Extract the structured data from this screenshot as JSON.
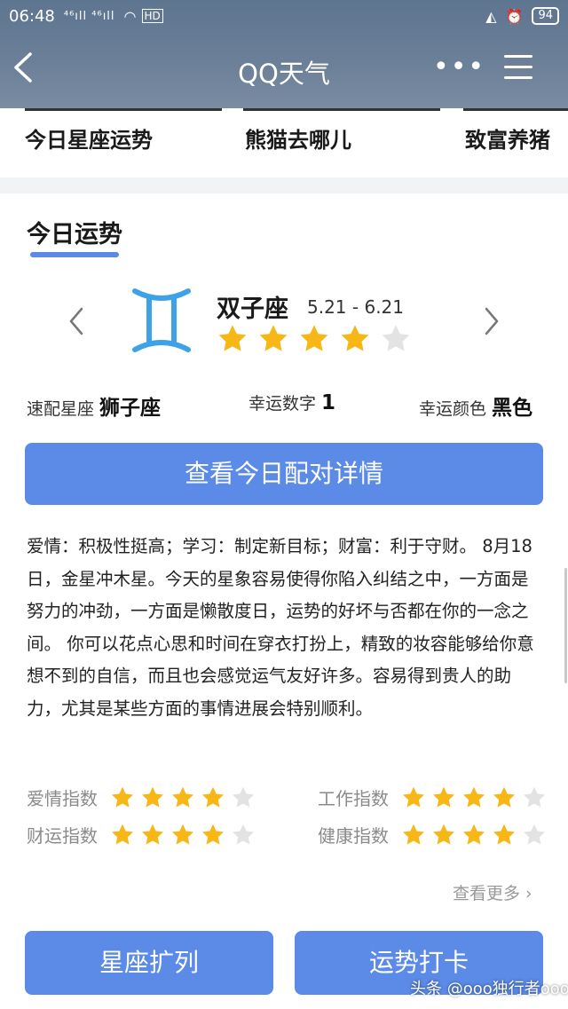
{
  "status_bar": {
    "time": "06:48",
    "signal": "⁴⁶ıll ⁴⁶ıll",
    "hd": "HD",
    "battery": "94"
  },
  "header": {
    "title": "QQ天气",
    "more": "•••"
  },
  "top_cards": [
    {
      "label": "今日星座运势"
    },
    {
      "label": "熊猫去哪儿"
    },
    {
      "label": "致富养猪"
    }
  ],
  "fortune": {
    "section_title": "今日运势",
    "sign_name": "双子座",
    "sign_dates": "5.21 - 6.21",
    "rating": 4,
    "max_rating": 5,
    "match_label": "速配星座",
    "match_value": "狮子座",
    "lucky_number_label": "幸运数字",
    "lucky_number_value": "1",
    "lucky_color_label": "幸运颜色",
    "lucky_color_value": "黑色",
    "detail_button": "查看今日配对详情",
    "description": "爱情：积极性挺高；学习：制定新目标；财富：利于守财。 8月18日，金星冲木星。今天的星象容易使得你陷入纠结之中，一方面是努力的冲劲，一方面是懒散度日，运势的好坏与否都在你的一念之间。 你可以花点心思和时间在穿衣打扮上，精致的妆容能够给你意想不到的自信，而且也会感觉运气友好许多。容易得到贵人的助力，尤其是某些方面的事情进展会特别顺利。",
    "indices": [
      {
        "label": "爱情指数",
        "rating": 4
      },
      {
        "label": "工作指数",
        "rating": 4
      },
      {
        "label": "财运指数",
        "rating": 4
      },
      {
        "label": "健康指数",
        "rating": 4
      }
    ],
    "see_more": "查看更多 ›"
  },
  "buttons": {
    "expand": "星座扩列",
    "checkin": "运势打卡"
  },
  "watermark": "头条 @ooo独行者ooo",
  "colors": {
    "accent": "#5b8ae7",
    "star_on": "#f7b817",
    "star_off": "#e3e3e3",
    "sign_icon": "#3ea2e8"
  }
}
